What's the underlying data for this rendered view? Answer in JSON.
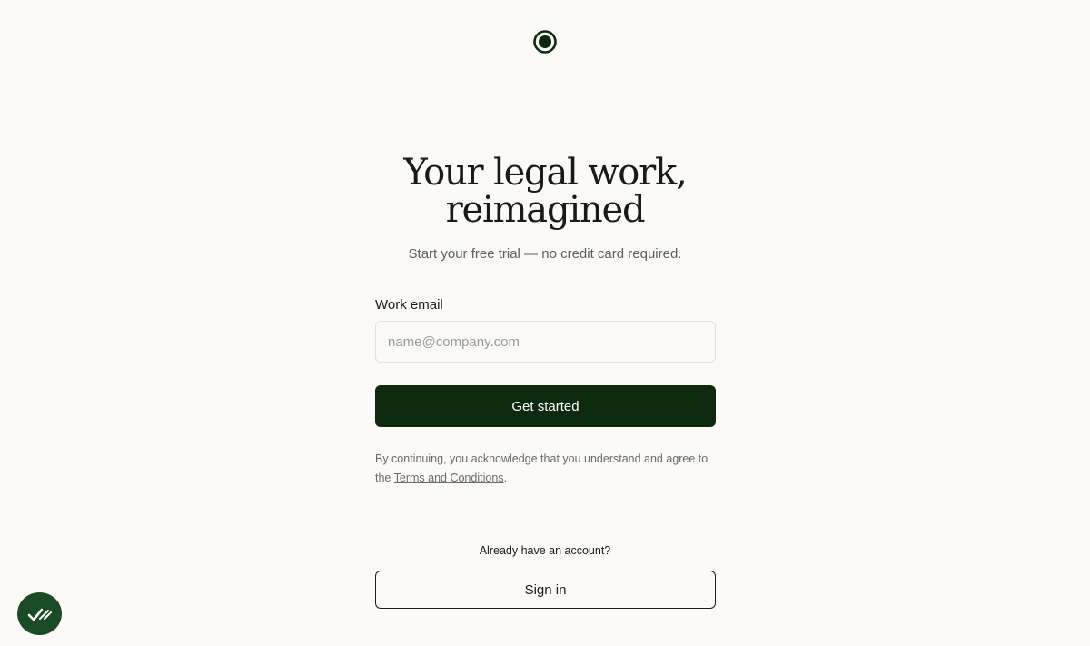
{
  "hero": {
    "title_line1": "Your legal work,",
    "title_line2": "reimagined",
    "subtitle": "Start your free trial — no credit card required."
  },
  "signup_form": {
    "email_label": "Work email",
    "email_placeholder": "name@company.com",
    "email_value": "",
    "submit_label": "Get started"
  },
  "legal": {
    "text_before": "By continuing, you acknowledge that you understand and agree to the ",
    "link_text": "Terms and Conditions",
    "text_after": "."
  },
  "signin": {
    "prompt": "Already have an account?",
    "button_label": "Sign in"
  },
  "icons": {
    "logo": "ring-dot-logo-icon",
    "widget": "checklist-icon"
  },
  "colors": {
    "background": "#fbfaf7",
    "primary": "#0d2a0e",
    "widget": "#1b4a26"
  }
}
